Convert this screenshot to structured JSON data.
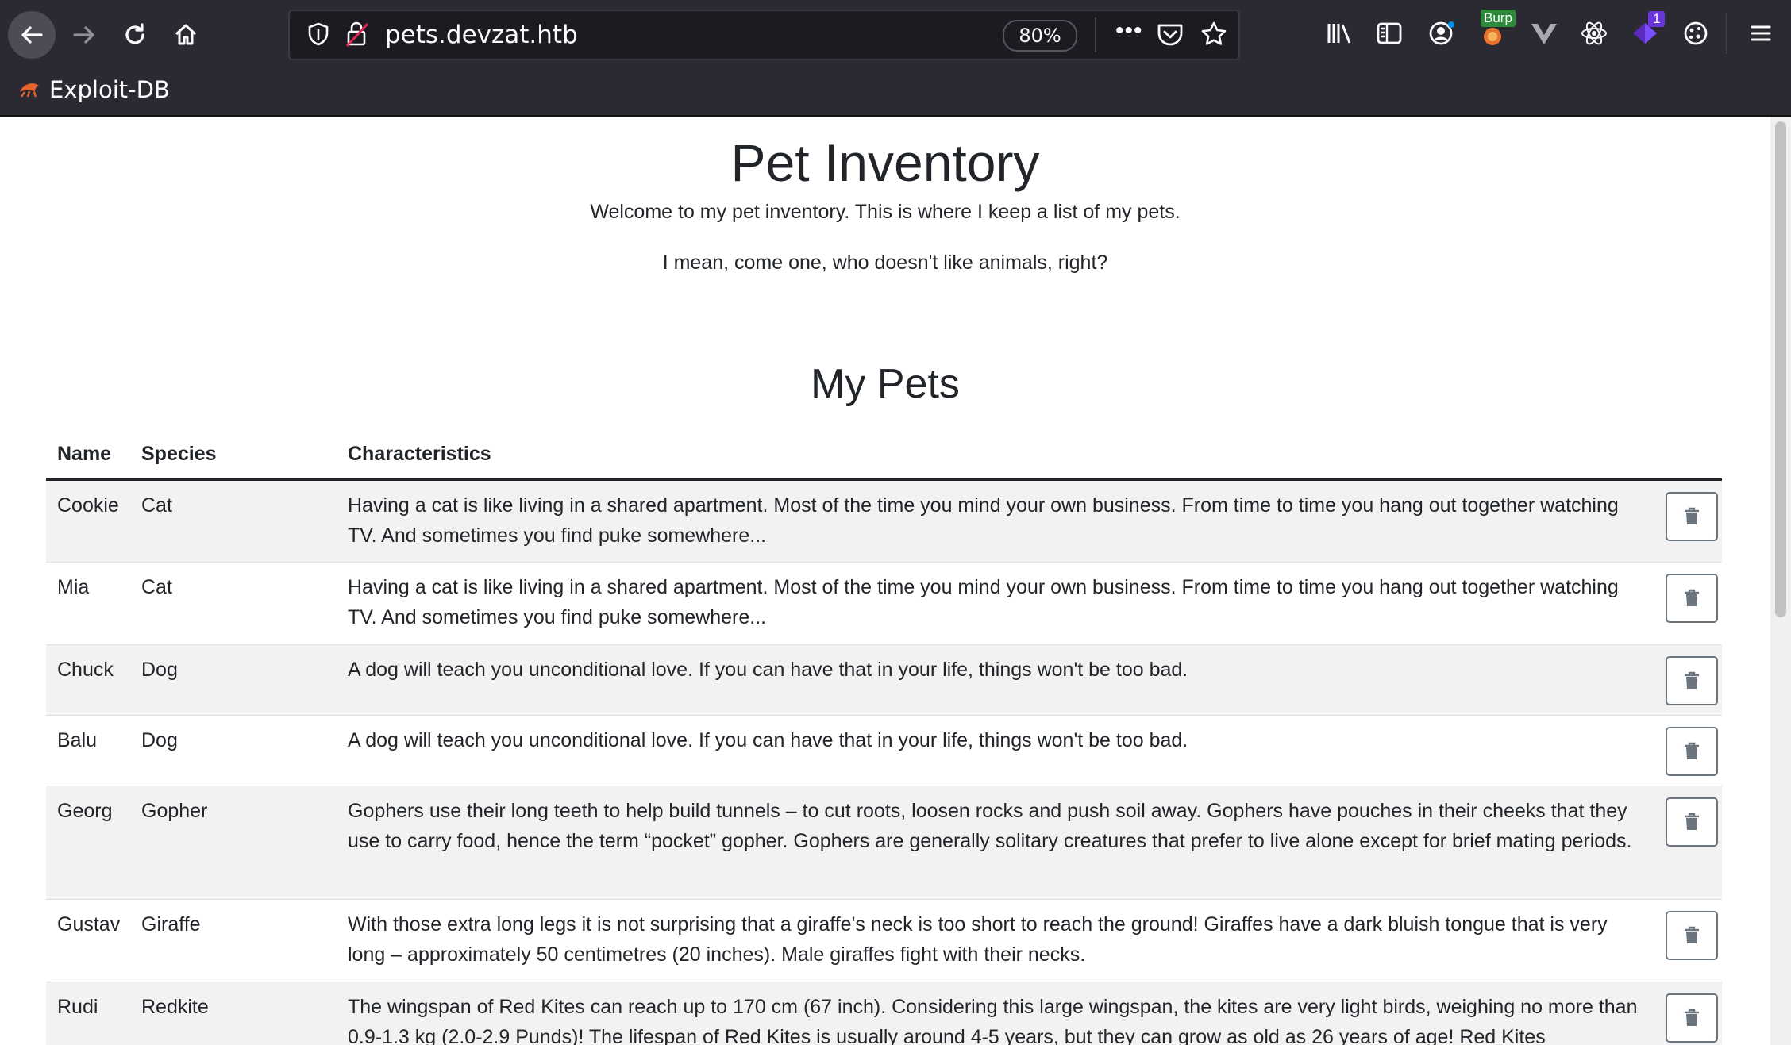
{
  "browser": {
    "url": "pets.devzat.htb",
    "zoom": "80%",
    "more_label": "•••",
    "burp_badge": "Burp",
    "extension_badge_count": "1",
    "bookmarks": [
      {
        "label": "Exploit-DB"
      }
    ]
  },
  "page": {
    "title": "Pet Inventory",
    "intro": "Welcome to my pet inventory. This is where I keep a list of my pets.",
    "intro2": "I mean, come one, who doesn't like animals, right?",
    "section_title": "My Pets",
    "columns": {
      "name": "Name",
      "species": "Species",
      "characteristics": "Characteristics"
    },
    "pets": [
      {
        "name": "Cookie",
        "species": "Cat",
        "characteristics": "Having a cat is like living in a shared apartment. Most of the time you mind your own business. From time to time you hang out together watching TV. And sometimes you find puke somewhere..."
      },
      {
        "name": "Mia",
        "species": "Cat",
        "characteristics": "Having a cat is like living in a shared apartment. Most of the time you mind your own business. From time to time you hang out together watching TV. And sometimes you find puke somewhere..."
      },
      {
        "name": "Chuck",
        "species": "Dog",
        "characteristics": "A dog will teach you unconditional love. If you can have that in your life, things won't be too bad."
      },
      {
        "name": "Balu",
        "species": "Dog",
        "characteristics": "A dog will teach you unconditional love. If you can have that in your life, things won't be too bad."
      },
      {
        "name": "Georg",
        "species": "Gopher",
        "characteristics": "Gophers use their long teeth to help build tunnels – to cut roots, loosen rocks and push soil away. Gophers have pouches in their cheeks that they use to carry food, hence the term “pocket” gopher. Gophers are generally solitary creatures that prefer to live alone except for brief mating periods."
      },
      {
        "name": "Gustav",
        "species": "Giraffe",
        "characteristics": "With those extra long legs it is not surprising that a giraffe's neck is too short to reach the ground! Giraffes have a dark bluish tongue that is very long – approximately 50 centimetres (20 inches). Male giraffes fight with their necks."
      },
      {
        "name": "Rudi",
        "species": "Redkite",
        "characteristics": "The wingspan of Red Kites can reach up to 170 cm (67 inch). Considering this large wingspan, the kites are very light birds, weighing no more than 0.9-1.3 kg (2.0-2.9 Punds)! The lifespan of Red Kites is usually around 4-5 years, but they can grow as old as 26 years of age! Red Kites"
      }
    ]
  },
  "icons": [
    "back-icon",
    "forward-icon",
    "reload-icon",
    "home-icon",
    "shield-icon",
    "insecure-lock-icon",
    "pocket-icon",
    "star-icon",
    "library-icon",
    "sidebar-icon",
    "account-icon",
    "burp-icon",
    "vue-icon",
    "react-icon",
    "extension-icon",
    "cookie-icon",
    "menu-icon",
    "exploit-db-icon",
    "trash-icon"
  ]
}
